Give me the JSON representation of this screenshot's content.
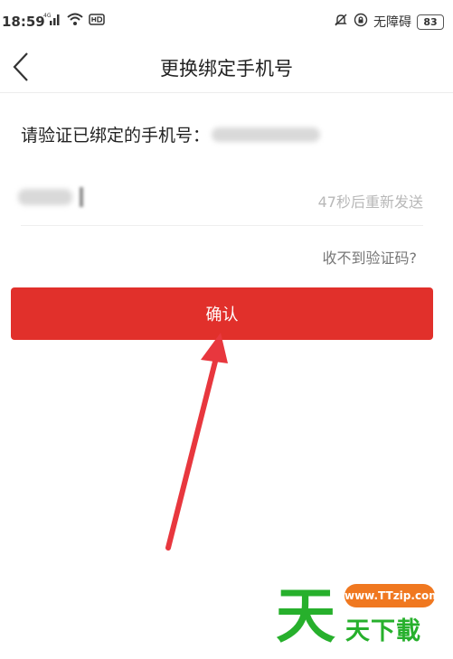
{
  "status_bar": {
    "time": "18:59",
    "accessibility_text": "无障碍",
    "battery": "83",
    "network_label": "4G"
  },
  "header": {
    "title": "更换绑定手机号"
  },
  "verify": {
    "prompt": "请验证已绑定的手机号：",
    "resend_countdown": "47秒后重新发送",
    "no_code_link": "收不到验证码?",
    "confirm_button": "确认"
  },
  "watermark": {
    "main_char": "天",
    "url": "www.TTzip.com",
    "sub_text": "天下載"
  },
  "colors": {
    "accent_red": "#e1302b",
    "watermark_green": "#27b02c",
    "watermark_orange": "#f07820"
  }
}
